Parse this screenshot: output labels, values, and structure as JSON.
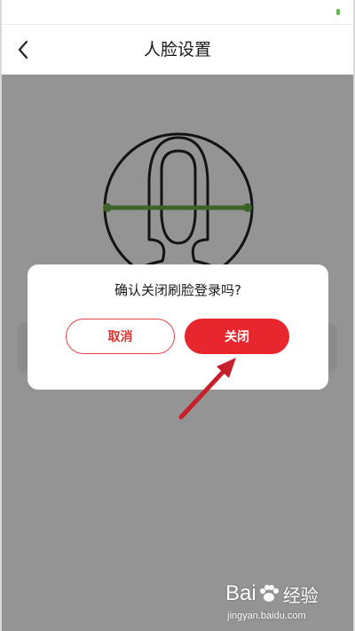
{
  "nav": {
    "title": "人脸设置",
    "back_icon": "chevron-left-icon"
  },
  "face_graphic": {
    "icon": "face-outline-icon",
    "scan_line_color": "#6aab47"
  },
  "dialog": {
    "message": "确认关闭刷脸登录吗?",
    "cancel_label": "取消",
    "confirm_label": "关闭"
  },
  "colors": {
    "accent_red": "#e8262d",
    "status_green": "#5fb84a"
  },
  "watermark": {
    "logo": "Baidu经验",
    "url": "jingyan.baidu.com"
  }
}
